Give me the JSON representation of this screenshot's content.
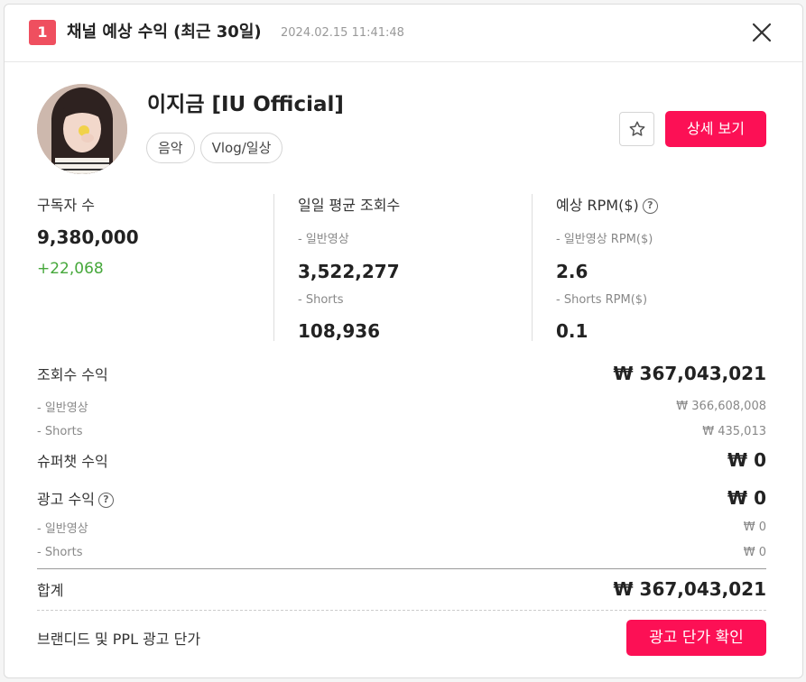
{
  "header": {
    "rank": "1",
    "title": "채널 예상 수익 (최근 30일)",
    "datetime": "2024.02.15 11:41:48",
    "close_icon": "close-icon"
  },
  "channel": {
    "name": "이지금 [IU Official]",
    "tags": [
      "음악",
      "Vlog/일상"
    ],
    "favorite_icon": "star-icon",
    "detail_button": "상세 보기"
  },
  "stats": {
    "subscribers": {
      "label": "구독자 수",
      "value": "9,380,000",
      "change": "+22,068"
    },
    "daily_views": {
      "label": "일일 평균 조회수",
      "normal_label": "- 일반영상",
      "normal_value": "3,522,277",
      "shorts_label": "- Shorts",
      "shorts_value": "108,936"
    },
    "rpm": {
      "label": "예상 RPM($)",
      "normal_label": "- 일반영상 RPM($)",
      "normal_value": "2.6",
      "shorts_label": "- Shorts RPM($)",
      "shorts_value": "0.1"
    }
  },
  "revenue": {
    "view_revenue": {
      "label": "조회수 수익",
      "value": "₩ 367,043,021"
    },
    "view_normal": {
      "label": "- 일반영상",
      "value": "₩ 366,608,008"
    },
    "view_shorts": {
      "label": "- Shorts",
      "value": "₩ 435,013"
    },
    "superchat": {
      "label": "슈퍼챗 수익",
      "value": "₩ 0"
    },
    "ad_revenue": {
      "label": "광고 수익",
      "value": "₩ 0"
    },
    "ad_normal": {
      "label": "- 일반영상",
      "value": "₩ 0"
    },
    "ad_shorts": {
      "label": "- Shorts",
      "value": "₩ 0"
    },
    "total": {
      "label": "합계",
      "value": "₩ 367,043,021"
    }
  },
  "brand": {
    "label": "브랜디드 및 PPL 광고 단가",
    "button": "광고 단가 확인"
  },
  "colors": {
    "accent": "#fc1055",
    "badge": "#ef4f5f",
    "positive": "#46a83b"
  }
}
